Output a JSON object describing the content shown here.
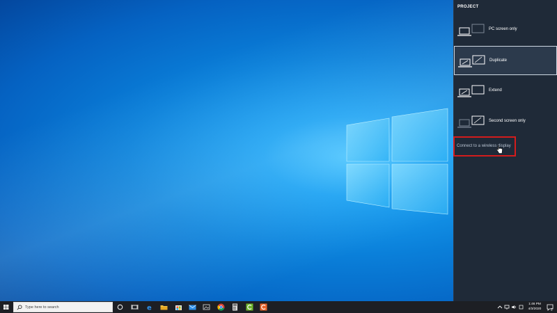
{
  "panel": {
    "title": "PROJECT",
    "options": [
      {
        "label": "PC screen only",
        "icon": "pc-screen-only-icon",
        "selected": false
      },
      {
        "label": "Duplicate",
        "icon": "duplicate-icon",
        "selected": true
      },
      {
        "label": "Extend",
        "icon": "extend-icon",
        "selected": false
      },
      {
        "label": "Second screen only",
        "icon": "second-screen-only-icon",
        "selected": false
      }
    ],
    "wireless_link": "Connect to a wireless display"
  },
  "taskbar": {
    "search_placeholder": "Type here to search",
    "clock": {
      "time": "1:46 PM",
      "date": "4/3/2020"
    },
    "notification_count": "2"
  },
  "colors": {
    "panel_bg": "#1f2a38",
    "highlight": "#d41c1c",
    "taskbar_bg": "#1d1f24",
    "accent": "#0a7fd9"
  }
}
